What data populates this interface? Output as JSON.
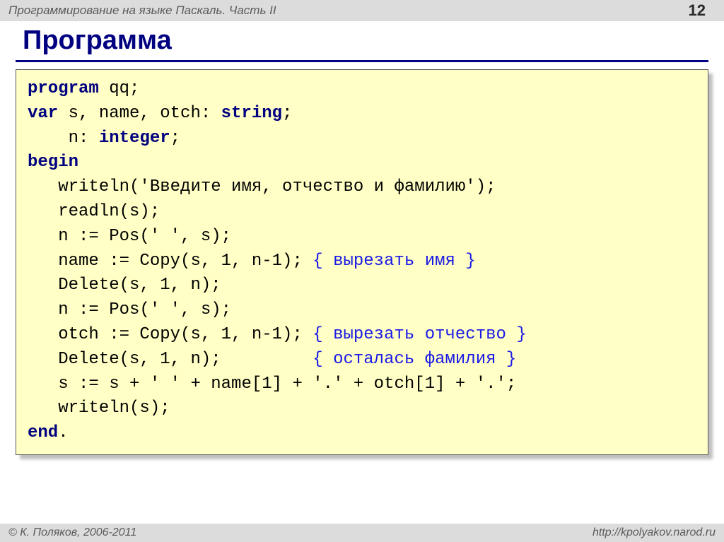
{
  "header": {
    "title": "Программирование на языке Паскаль. Часть II",
    "page_number": "12"
  },
  "heading": "Программа",
  "code": {
    "l1_kw": "program",
    "l1_rest": " qq;",
    "l2_kw": "var",
    "l2_rest": " s, name, otch: ",
    "l2_kw2": "string",
    "l2_end": ";",
    "l3_pad": "    n: ",
    "l3_kw": "integer",
    "l3_end": ";",
    "l4_kw": "begin",
    "l5": "   writeln('Введите имя, отчество и фамилию');",
    "l6": "   readln(s);",
    "l7": "   n := Pos(' ', s);",
    "l8a": "   name := Copy(s, 1, n-1); ",
    "l8c": "{ вырезать имя }",
    "l9": "   Delete(s, 1, n);",
    "l10": "   n := Pos(' ', s);",
    "l11a": "   otch := Copy(s, 1, n-1); ",
    "l11c": "{ вырезать отчество }",
    "l12a": "   Delete(s, 1, n);         ",
    "l12c": "{ осталась фамилия }",
    "l13": "   s := s + ' ' + name[1] + '.' + otch[1] + '.';",
    "l14": "   writeln(s);",
    "l15_kw": "end",
    "l15_end": "."
  },
  "footer": {
    "copyright": "© К. Поляков, 2006-2011",
    "url": "http://kpolyakov.narod.ru"
  }
}
